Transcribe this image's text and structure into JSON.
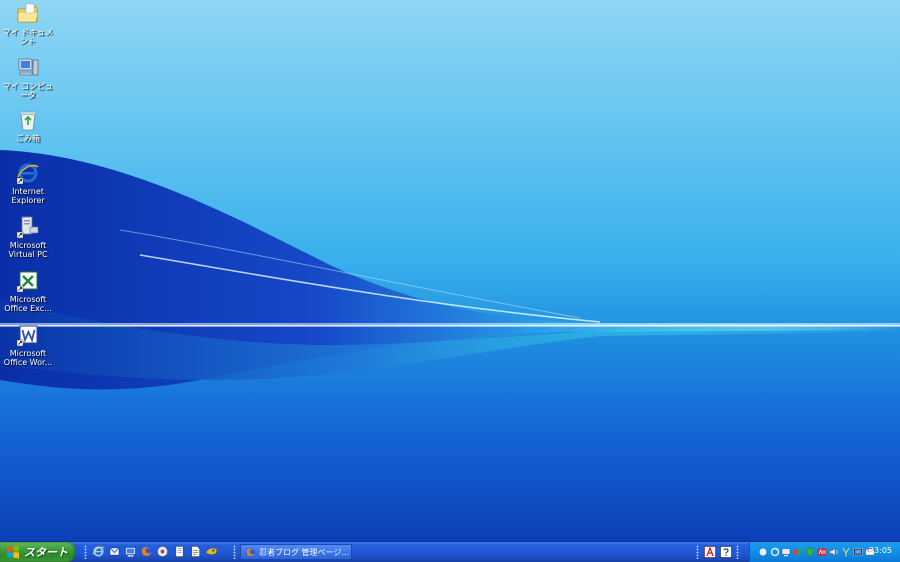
{
  "desktop": {
    "icons": [
      {
        "id": "my-documents",
        "label": "マイ ドキュメント",
        "icon": "folder-icon"
      },
      {
        "id": "my-computer",
        "label": "マイ コンピュータ",
        "icon": "computer-icon"
      },
      {
        "id": "recycle-bin",
        "label": "ごみ箱",
        "icon": "recycle-bin-icon"
      },
      {
        "id": "internet-explorer",
        "label": "Internet\nExplorer",
        "icon": "internet-explorer-icon"
      },
      {
        "id": "virtual-pc",
        "label": "Microsoft\nVirtual PC",
        "icon": "virtual-pc-icon"
      },
      {
        "id": "office-excel",
        "label": "Microsoft\nOffice Exc...",
        "icon": "excel-icon"
      },
      {
        "id": "office-word",
        "label": "Microsoft\nOffice Wor...",
        "icon": "word-icon"
      }
    ]
  },
  "taskbar": {
    "start_label": "スタート",
    "quick_launch": [
      "internet-explorer-icon",
      "outlook-icon",
      "show-desktop-icon",
      "firefox-icon",
      "media-icon",
      "notepad-icon",
      "document-icon",
      "app-icon"
    ],
    "task_button_label": "忍者ブログ 管理ページ...",
    "language_bar": [
      "acrobat-icon",
      "help-icon"
    ],
    "tray_icons": [
      "network-icon",
      "sync-icon",
      "monitor-icon",
      "chat-icon",
      "shield-icon",
      "antivirus-icon",
      "volume-icon",
      "antenna-icon",
      "display-icon",
      "mail-icon"
    ],
    "clock": "23:05"
  },
  "colors": {
    "taskbar_blue": "#245edb",
    "start_green": "#3c9a3a",
    "tray_blue": "#108fe8"
  }
}
